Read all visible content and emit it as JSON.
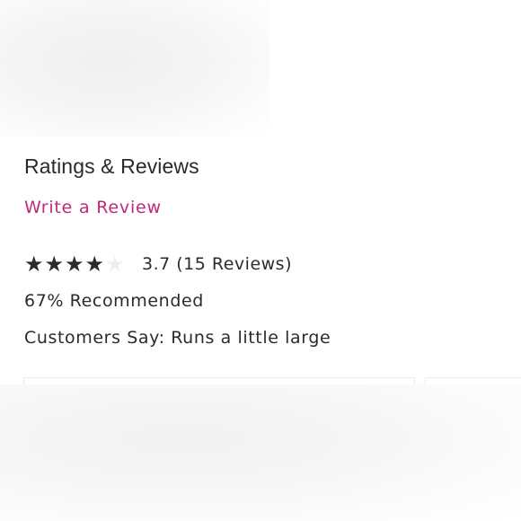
{
  "reviews": {
    "heading": "Ratings & Reviews",
    "write_review_label": "Write a Review",
    "rating": 3.7,
    "rating_max": 5,
    "rating_summary": "3.7 (15 Reviews)",
    "recommended": "67% Recommended",
    "customers_say": "Customers Say: Runs a little large"
  },
  "colors": {
    "accent": "#c0297a",
    "text": "#2b2b2b",
    "star_filled": "#2b2b2b",
    "star_empty": "#eeeeee"
  },
  "icons": {
    "star": "star-icon"
  }
}
